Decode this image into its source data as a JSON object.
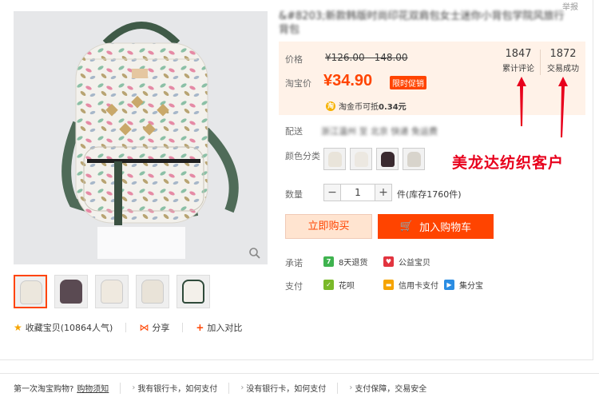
{
  "header": {
    "title": "&#8203;新款韩版时尚印花双肩包女士迷你小背包学院风旅行背包",
    "report_label": "举报"
  },
  "price": {
    "label": "价格",
    "original": "¥126.00 - 148.00",
    "taobao_label": "淘宝价",
    "current": "¥34.90",
    "promo_tag": "限时促销",
    "coin_icon": "淘",
    "coin_text": "淘金币可抵",
    "coin_amount": "0.34元"
  },
  "stats": {
    "reviews_count": "1847",
    "reviews_label": "累计评论",
    "sales_count": "1872",
    "sales_label": "交易成功"
  },
  "shipping": {
    "label": "配送",
    "text": "浙江温州 至 北京 快递 免运费"
  },
  "colors": {
    "label": "颜色分类",
    "swatches": [
      "#e9e4da",
      "#ece8e1",
      "#3a2a30",
      "#d8d4cc"
    ]
  },
  "watermark": "美龙达纺织客户",
  "quantity": {
    "label": "数量",
    "minus": "−",
    "value": "1",
    "plus": "+",
    "stock": "件(库存1760件)"
  },
  "buttons": {
    "buy_now": "立即购买",
    "add_cart": "加入购物车",
    "cart_icon": "🛒"
  },
  "promise": {
    "label": "承诺",
    "items": [
      {
        "icon": "7",
        "text": "8天退货",
        "color": "#3fb34f"
      },
      {
        "icon": "♥",
        "text": "公益宝贝",
        "color": "#e2343f"
      }
    ]
  },
  "payment": {
    "label": "支付",
    "items": [
      {
        "icon": "✓",
        "text": "花呗",
        "color": "#7ab929"
      },
      {
        "icon": "▬",
        "text": "信用卡支付",
        "color": "#f6a400"
      },
      {
        "icon": "▶",
        "text": "集分宝",
        "color": "#2b8de3"
      }
    ]
  },
  "actions": {
    "favorite_icon": "★",
    "favorite": "收藏宝贝",
    "favorite_count": "(10864人气)",
    "share_icon": "⋈",
    "share": "分享",
    "compare_icon": "+",
    "compare": "加入对比"
  },
  "footer": {
    "first_time": "第一次淘宝购物?",
    "guide_link": "购物须知",
    "has_card": "我有银行卡，如何支付",
    "no_card": "没有银行卡，如何支付",
    "guarantee": "支付保障，交易安全"
  },
  "accent_color": "#ff4400"
}
